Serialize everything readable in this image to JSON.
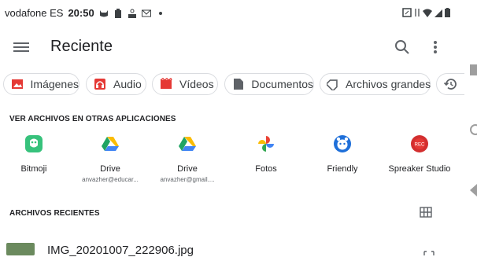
{
  "status_bar": {
    "carrier": "vodafone ES",
    "time": "20:50"
  },
  "app_bar": {
    "title": "Reciente",
    "menu_icon": "menu-icon",
    "search_icon": "search-icon",
    "more_icon": "more-vert-icon"
  },
  "chips": [
    {
      "label": "Imágenes",
      "icon": "image-icon",
      "color": "#e53935"
    },
    {
      "label": "Audio",
      "icon": "headphones-icon",
      "color": "#e53935"
    },
    {
      "label": "Vídeos",
      "icon": "movie-icon",
      "color": "#e53935"
    },
    {
      "label": "Documentos",
      "icon": "document-icon",
      "color": "#5f6368"
    },
    {
      "label": "Archivos grandes",
      "icon": "label-icon",
      "color": "#5f6368"
    },
    {
      "label": "",
      "icon": "history-icon",
      "color": "#5f6368"
    }
  ],
  "other_apps": {
    "heading": "VER ARCHIVOS EN OTRAS APLICACIONES",
    "items": [
      {
        "name": "Bitmoji",
        "sub": "",
        "icon": "bitmoji-icon"
      },
      {
        "name": "Drive",
        "sub": "anvazher@educar...",
        "icon": "drive-icon"
      },
      {
        "name": "Drive",
        "sub": "anvazher@gmail....",
        "icon": "drive-icon"
      },
      {
        "name": "Fotos",
        "sub": "",
        "icon": "photos-icon"
      },
      {
        "name": "Friendly",
        "sub": "",
        "icon": "friendly-icon"
      },
      {
        "name": "Spreaker Studio",
        "sub": "",
        "icon": "spreaker-icon"
      }
    ]
  },
  "recent_files": {
    "heading": "ARCHIVOS RECIENTES",
    "items": [
      {
        "name": "IMG_20201007_222906.jpg"
      }
    ]
  }
}
